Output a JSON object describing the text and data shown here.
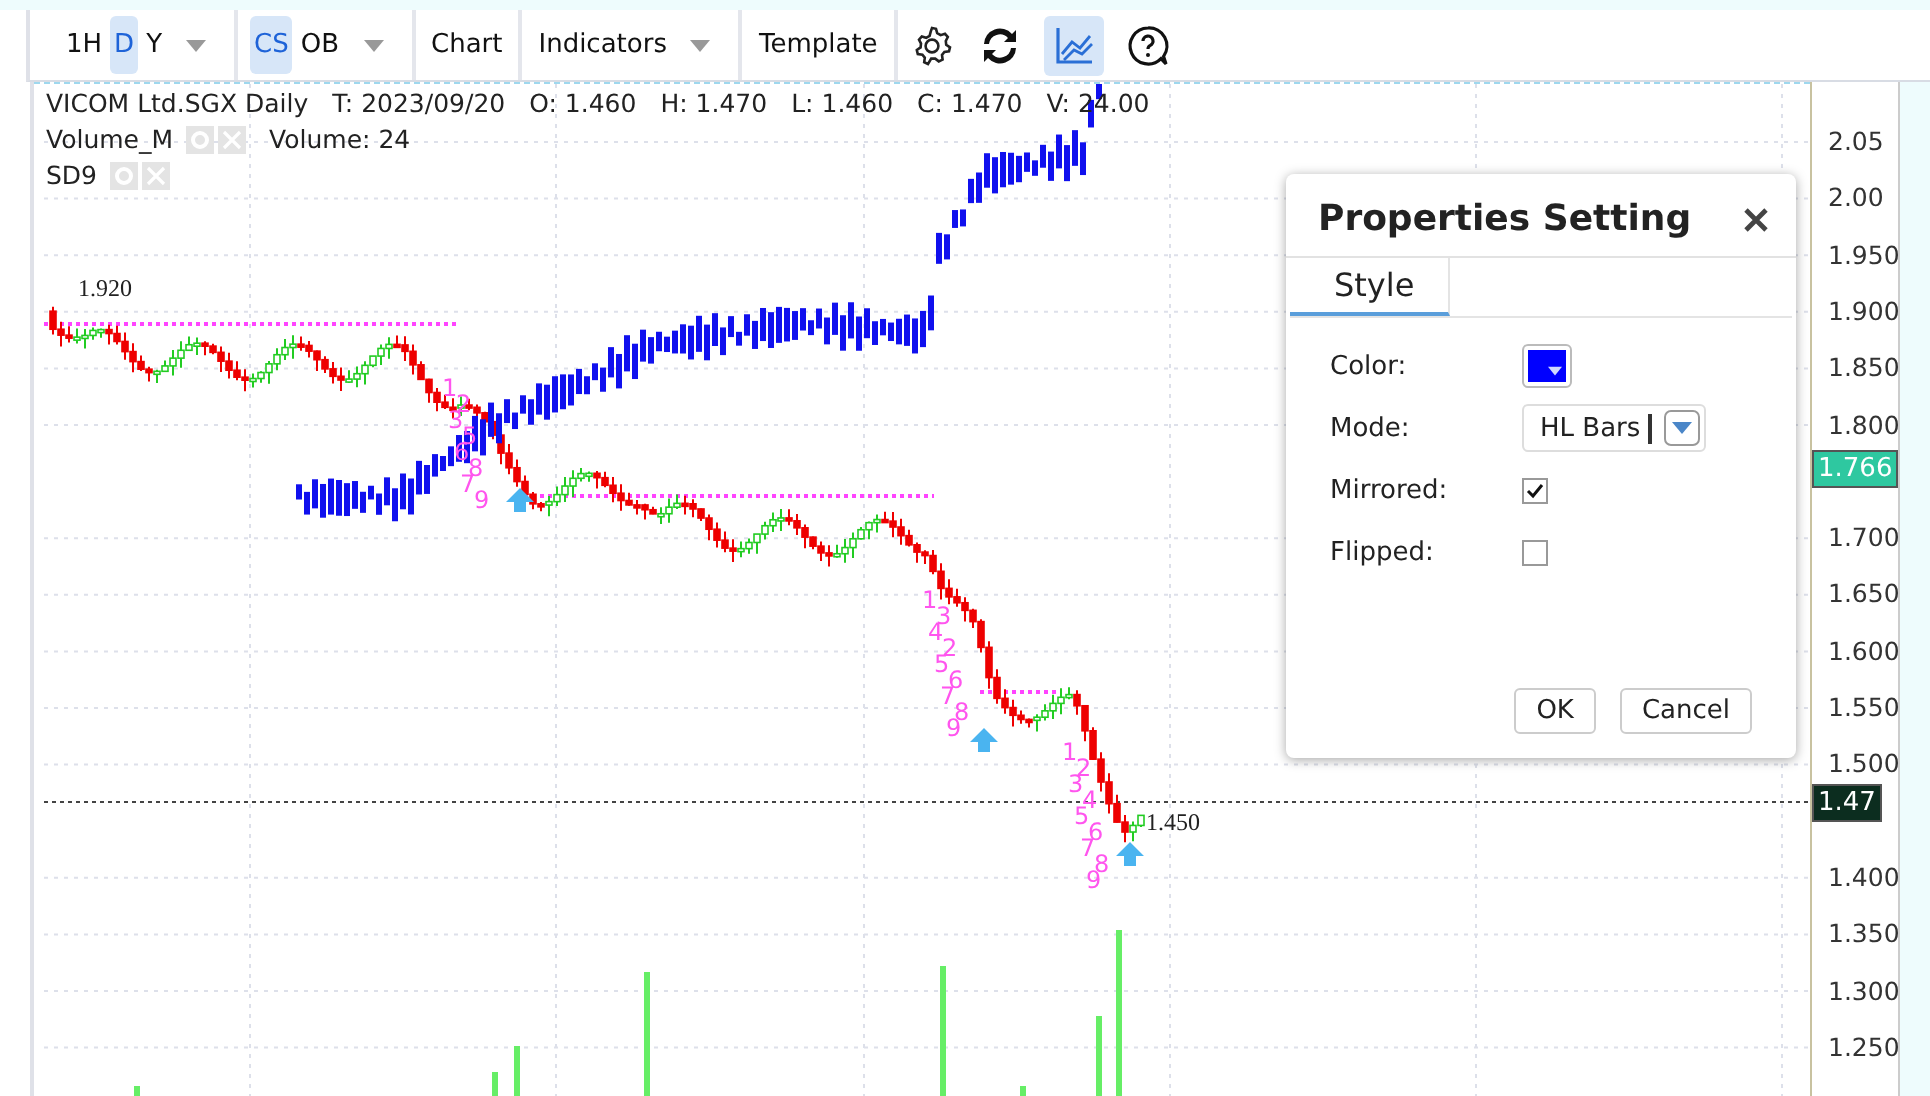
{
  "toolbar": {
    "periods": [
      {
        "label": "1H",
        "selected": false
      },
      {
        "label": "D",
        "selected": true
      },
      {
        "label": "Y",
        "selected": false
      }
    ],
    "styles": [
      {
        "label": "CS",
        "selected": true
      },
      {
        "label": "OB",
        "selected": false
      }
    ],
    "menus": [
      {
        "label": "Chart",
        "dropdown": false
      },
      {
        "label": "Indicators",
        "dropdown": true
      },
      {
        "label": "Template",
        "dropdown": false
      }
    ],
    "chart_toggle_selected": true
  },
  "legend": {
    "title": "VICOM Ltd.SGX Daily",
    "fields": [
      "T: 2023/09/20",
      "O: 1.460",
      "H: 1.470",
      "L: 1.460",
      "C: 1.470",
      "V: 24.00"
    ],
    "indicators": [
      {
        "name": "Volume_M",
        "value": "Volume: 24"
      },
      {
        "name": "SD9"
      }
    ]
  },
  "chart": {
    "y_axis_labels": [
      "2.05",
      "2.00",
      "1.950",
      "1.900",
      "1.850",
      "1.800",
      "1.700",
      "1.650",
      "1.600",
      "1.550",
      "1.500",
      "1.400",
      "1.350",
      "1.300",
      "1.250"
    ],
    "price_tags": [
      {
        "text": "1.766",
        "color": "#2ec8a0"
      },
      {
        "text": "1.47",
        "color": "#0c2d1f"
      }
    ],
    "annotations": [
      "1.920",
      "1.450"
    ],
    "td_counts": [
      {
        "digits": [
          "1",
          "2",
          "3",
          "5",
          "6",
          "8",
          "7",
          "9"
        ]
      },
      {
        "digits": [
          "1",
          "3",
          "4",
          "2",
          "5",
          "6",
          "7",
          "8",
          "9"
        ]
      },
      {
        "digits": [
          "1",
          "2",
          "3",
          "4",
          "5",
          "6",
          "7",
          "8",
          "9"
        ]
      }
    ]
  },
  "dialog": {
    "title": "Properties Setting",
    "tabs": [
      {
        "label": "Style",
        "selected": true
      }
    ],
    "fields": [
      {
        "kind": "color",
        "label": "Color:",
        "color": "#0000ff"
      },
      {
        "kind": "select",
        "label": "Mode:",
        "value": "HL Bars"
      },
      {
        "kind": "checkbox",
        "label": "Mirrored:",
        "checked": true
      },
      {
        "kind": "checkbox",
        "label": "Flipped:",
        "checked": false
      }
    ],
    "buttons": [
      "OK",
      "Cancel"
    ]
  }
}
